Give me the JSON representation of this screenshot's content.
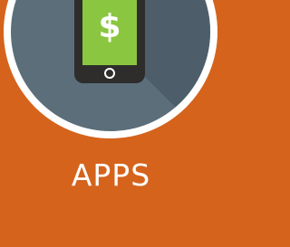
{
  "tile": {
    "label": "APPS",
    "icon": "mobile-payment-icon",
    "glyph": "$"
  },
  "colors": {
    "background": "#d5631c",
    "ring": "#ffffff",
    "disc": "#5b6e7a",
    "shadow": "#4b5c67",
    "phone": "#2e2d2b",
    "screen": "#8bc640",
    "glyph": "#ffffff"
  }
}
